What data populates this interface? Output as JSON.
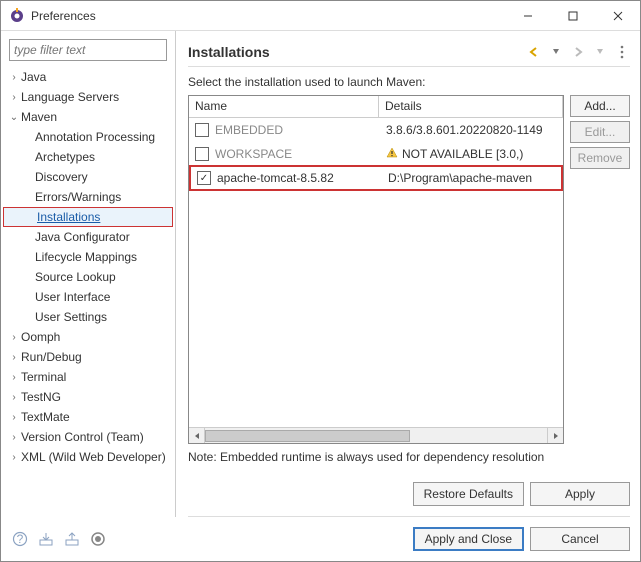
{
  "window": {
    "title": "Preferences"
  },
  "filter": {
    "placeholder": "type filter text"
  },
  "tree": [
    {
      "label": "Java",
      "expandable": true,
      "expanded": false
    },
    {
      "label": "Language Servers",
      "expandable": true,
      "expanded": false
    },
    {
      "label": "Maven",
      "expandable": true,
      "expanded": true,
      "children": [
        {
          "label": "Annotation Processing"
        },
        {
          "label": "Archetypes"
        },
        {
          "label": "Discovery"
        },
        {
          "label": "Errors/Warnings"
        },
        {
          "label": "Installations",
          "selected": true
        },
        {
          "label": "Java Configurator"
        },
        {
          "label": "Lifecycle Mappings"
        },
        {
          "label": "Source Lookup"
        },
        {
          "label": "User Interface"
        },
        {
          "label": "User Settings"
        }
      ]
    },
    {
      "label": "Oomph",
      "expandable": true,
      "expanded": false
    },
    {
      "label": "Run/Debug",
      "expandable": true,
      "expanded": false
    },
    {
      "label": "Terminal",
      "expandable": true,
      "expanded": false
    },
    {
      "label": "TestNG",
      "expandable": true,
      "expanded": false
    },
    {
      "label": "TextMate",
      "expandable": true,
      "expanded": false
    },
    {
      "label": "Version Control (Team)",
      "expandable": true,
      "expanded": false
    },
    {
      "label": "XML (Wild Web Developer)",
      "expandable": true,
      "expanded": false
    }
  ],
  "page": {
    "title": "Installations",
    "desc": "Select the installation used to launch Maven:",
    "columns": {
      "name": "Name",
      "details": "Details"
    },
    "rows": [
      {
        "checked": false,
        "disabled": true,
        "name": "EMBEDDED",
        "details": "3.8.6/3.8.601.20220820-1149"
      },
      {
        "checked": false,
        "disabled": true,
        "warn": true,
        "name": "WORKSPACE",
        "details": "NOT AVAILABLE [3.0,)"
      },
      {
        "checked": true,
        "disabled": false,
        "highlight": true,
        "name": "apache-tomcat-8.5.82",
        "details": "D:\\Program\\apache-maven"
      }
    ],
    "buttons": {
      "add": "Add...",
      "edit": "Edit...",
      "remove": "Remove"
    },
    "note": "Note: Embedded runtime is always used for dependency resolution",
    "restore": "Restore Defaults",
    "apply": "Apply"
  },
  "footer": {
    "apply_close": "Apply and Close",
    "cancel": "Cancel"
  }
}
